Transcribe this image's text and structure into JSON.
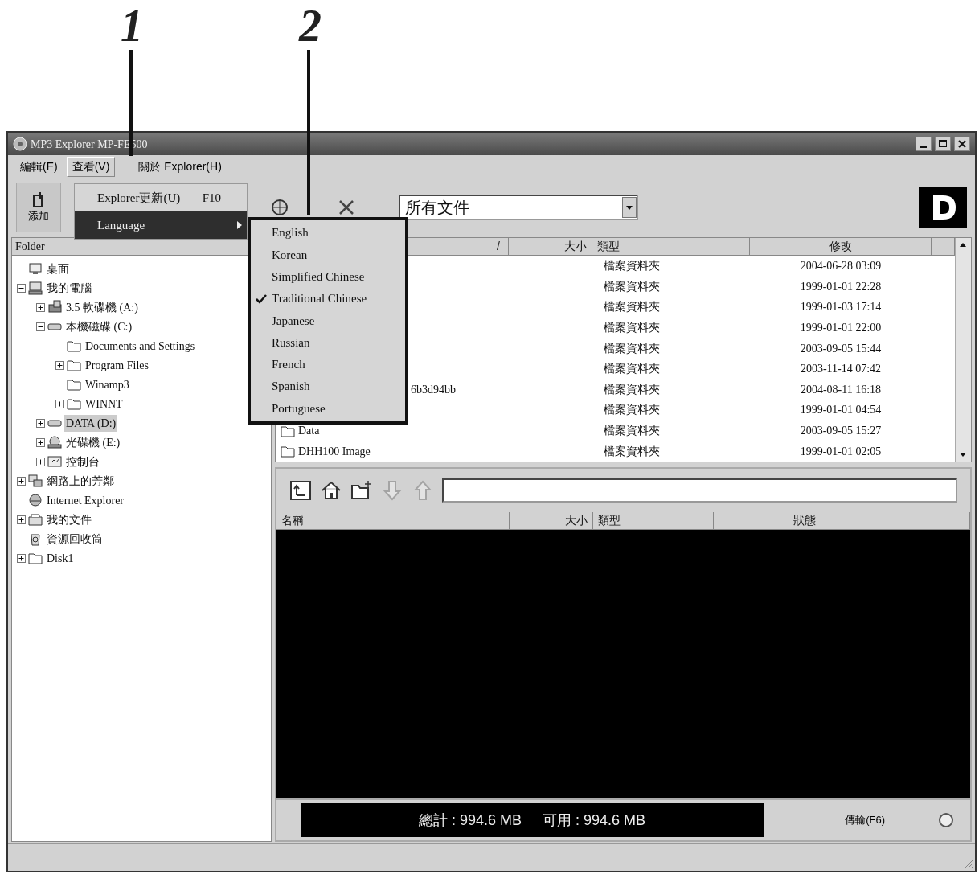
{
  "callouts": [
    {
      "label": "1"
    },
    {
      "label": "2"
    }
  ],
  "window": {
    "title": "MP3 Explorer MP-FE500"
  },
  "menu_bar": [
    {
      "label": "編輯(E)",
      "selected": false
    },
    {
      "label": "查看(V)",
      "selected": true
    },
    {
      "label": "關於 Explorer(H)",
      "selected": false
    }
  ],
  "view_menu": [
    {
      "label": "Explorer更新(U)",
      "shortcut": "F10",
      "selected": false,
      "submenu": false
    },
    {
      "label": "Language",
      "selected": true,
      "submenu": true
    }
  ],
  "language_menu": [
    {
      "label": "English",
      "checked": false
    },
    {
      "label": "Korean",
      "checked": false
    },
    {
      "label": "Simplified Chinese",
      "checked": false
    },
    {
      "label": "Traditional Chinese",
      "checked": true
    },
    {
      "label": "Japanese",
      "checked": false
    },
    {
      "label": "Russian",
      "checked": false
    },
    {
      "label": "French",
      "checked": false
    },
    {
      "label": "Spanish",
      "checked": false
    },
    {
      "label": "Portuguese",
      "checked": false
    }
  ],
  "toolbar": {
    "add_button": "添加",
    "filter": {
      "value": "所有文件"
    }
  },
  "folder_pane": {
    "title": "Folder",
    "tree": [
      {
        "label": "桌面",
        "kind": "desktop",
        "selected": false
      },
      {
        "label": "我的電腦",
        "kind": "computer",
        "selected": false,
        "expanded": true,
        "children": [
          {
            "label": "3.5 軟碟機 (A:)",
            "kind": "floppy",
            "selected": false,
            "expanded": false
          },
          {
            "label": "本機磁碟 (C:)",
            "kind": "drive",
            "selected": false,
            "expanded": true,
            "children": [
              {
                "label": "Documents and Settings",
                "kind": "folder",
                "selected": false
              },
              {
                "label": "Program Files",
                "kind": "folder",
                "selected": false,
                "expanded": false
              },
              {
                "label": "Winamp3",
                "kind": "folder",
                "selected": false
              },
              {
                "label": "WINNT",
                "kind": "folder",
                "selected": false,
                "expanded": false
              }
            ]
          },
          {
            "label": "DATA (D:)",
            "kind": "drive",
            "selected": true,
            "expanded": false
          },
          {
            "label": "光碟機 (E:)",
            "kind": "cdrom",
            "selected": false,
            "expanded": false
          },
          {
            "label": "控制台",
            "kind": "control-panel",
            "selected": false,
            "expanded": false
          }
        ]
      },
      {
        "label": "網路上的芳鄰",
        "kind": "network",
        "selected": false,
        "expanded": false
      },
      {
        "label": "Internet Explorer",
        "kind": "browser",
        "selected": false
      },
      {
        "label": "我的文件",
        "kind": "documents",
        "selected": false,
        "expanded": false
      },
      {
        "label": "資源回收筒",
        "kind": "recycle",
        "selected": false
      },
      {
        "label": "Disk1",
        "kind": "folder",
        "selected": false,
        "expanded": false
      }
    ]
  },
  "file_list": {
    "columns": [
      "/",
      "大小",
      "類型",
      "修改"
    ],
    "rows": [
      {
        "kind": "covered",
        "type": "檔案資料夾",
        "modified": "2004-06-28 03:09"
      },
      {
        "kind": "covered",
        "type": "檔案資料夾",
        "modified": "1999-01-01 22:28"
      },
      {
        "kind": "covered",
        "type": "檔案資料夾",
        "modified": "1999-01-03 17:14"
      },
      {
        "kind": "covered",
        "type": "檔案資料夾",
        "modified": "1999-01-01 22:00"
      },
      {
        "kind": "covered",
        "type": "檔案資料夾",
        "modified": "2003-09-05 15:44"
      },
      {
        "kind": "covered",
        "type": "檔案資料夾",
        "modified": "2003-11-14 07:42"
      },
      {
        "kind": "partial",
        "name": "6b3d94bb",
        "type": "檔案資料夾",
        "modified": "2004-08-11 16:18"
      },
      {
        "kind": "covered",
        "type": "檔案資料夾",
        "modified": "1999-01-01 04:54"
      },
      {
        "kind": "folder",
        "name": "Data",
        "type": "檔案資料夾",
        "modified": "2003-09-05 15:27"
      },
      {
        "kind": "folder",
        "name": "DHH100 Image",
        "type": "檔案資料夾",
        "modified": "1999-01-01 02:05"
      }
    ]
  },
  "transfer_pane": {
    "tools": [
      {
        "kind": "folder-up",
        "disabled": false
      },
      {
        "kind": "home",
        "disabled": false
      },
      {
        "kind": "new-folder",
        "disabled": false
      },
      {
        "kind": "down",
        "disabled": true
      },
      {
        "kind": "up",
        "disabled": true
      }
    ],
    "columns": [
      "名稱",
      "大小",
      "類型",
      "狀態"
    ],
    "total": "總計 : 994.6 MB",
    "free": "可用 : 994.6 MB",
    "transfer_button": "傳輸(F6)"
  }
}
